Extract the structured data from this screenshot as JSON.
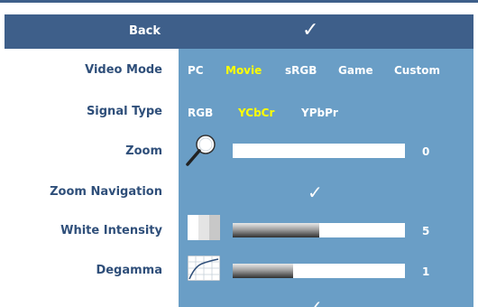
{
  "header": {
    "back_label": "Back",
    "back_icon": "checkmark"
  },
  "rows": {
    "video_mode": {
      "label": "Video Mode",
      "options": [
        "PC",
        "Movie",
        "sRGB",
        "Game",
        "Custom"
      ],
      "selected": "Movie"
    },
    "signal_type": {
      "label": "Signal Type",
      "options": [
        "RGB",
        "YCbCr",
        "YPbPr"
      ],
      "selected": "YCbCr"
    },
    "zoom": {
      "label": "Zoom",
      "value": "0",
      "level": 0,
      "icon": "magnifier-icon"
    },
    "zoom_navigation": {
      "label": "Zoom Navigation",
      "icon": "checkmark"
    },
    "white_intensity": {
      "label": "White Intensity",
      "value": "5",
      "level": 0.5,
      "icon": "white-intensity-icon"
    },
    "degamma": {
      "label": "Degamma",
      "value": "1",
      "level": 0.35,
      "icon": "degamma-curve-icon"
    },
    "partial_row": {
      "label": "",
      "icon": "checkmark"
    }
  },
  "colors": {
    "header_bg": "#3e5f8a",
    "panel_bg": "#6a9ec6",
    "label_text": "#2f4f7a",
    "selected_option": "#ffff00",
    "option_text": "#ffffff"
  }
}
